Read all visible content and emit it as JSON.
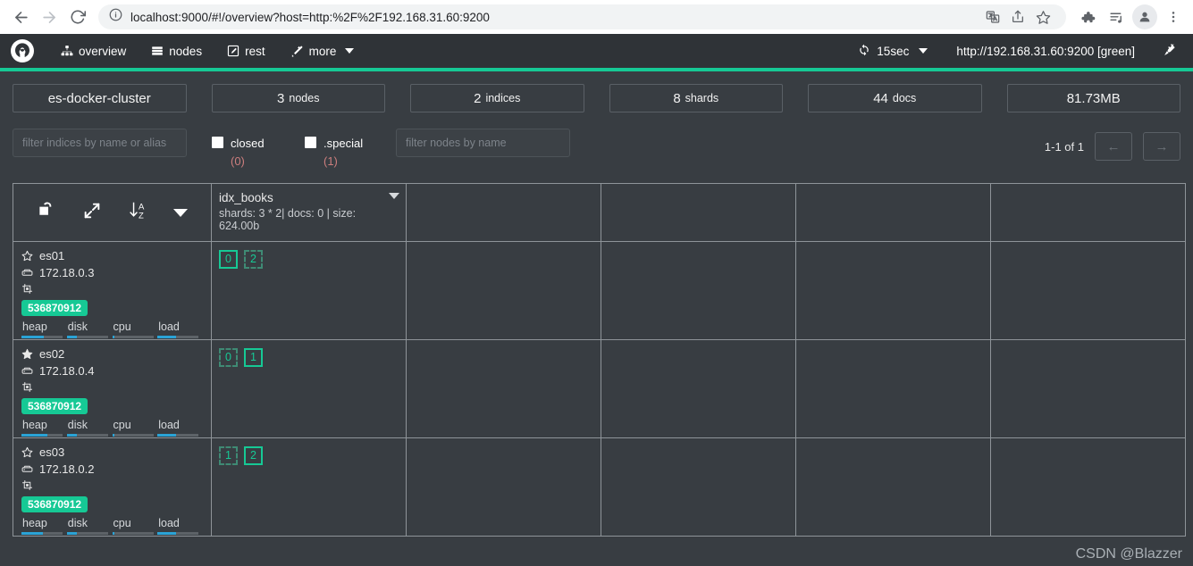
{
  "browser": {
    "url": "localhost:9000/#!/overview?host=http:%2F%2F192.168.31.60:9200",
    "back_icon": "back-arrow-icon",
    "forward_icon": "forward-arrow-icon",
    "reload_icon": "reload-icon",
    "info_icon": "site-info-icon",
    "translate_icon": "translate-icon",
    "share_icon": "share-icon",
    "bookmark_icon": "star-icon",
    "extensions_icon": "puzzle-icon",
    "reading_list_icon": "reading-list-icon",
    "profile_icon": "profile-avatar-icon",
    "menu_icon": "three-dot-menu-icon"
  },
  "app_header": {
    "logo": "cerebro-logo",
    "nav": [
      {
        "label": "overview",
        "icon": "sitemap-icon"
      },
      {
        "label": "nodes",
        "icon": "server-icon"
      },
      {
        "label": "rest",
        "icon": "edit-square-icon"
      },
      {
        "label": "more",
        "icon": "magic-wand-icon",
        "has_caret": true
      }
    ],
    "refresh": {
      "icon": "refresh-icon",
      "interval": "15sec"
    },
    "cluster_url": "http://192.168.31.60:9200 [green]",
    "disconnect_icon": "plug-icon"
  },
  "stats": [
    {
      "value": "es-docker-cluster",
      "label": ""
    },
    {
      "value": "3",
      "label": "nodes"
    },
    {
      "value": "2",
      "label": "indices"
    },
    {
      "value": "8",
      "label": "shards"
    },
    {
      "value": "44",
      "label": "docs"
    },
    {
      "value": "81.73MB",
      "label": ""
    }
  ],
  "filters": {
    "indices_placeholder": "filter indices by name or alias",
    "indices_value": "",
    "nodes_placeholder": "filter nodes by name",
    "nodes_value": "",
    "checkboxes": [
      {
        "label": "closed",
        "count": "(0)",
        "checked": false
      },
      {
        "label": ".special",
        "count": "(1)",
        "checked": false
      }
    ]
  },
  "pagination": {
    "text": "1-1 of 1",
    "prev": "←",
    "next": "→"
  },
  "table": {
    "controls": [
      {
        "icon": "unlock-icon"
      },
      {
        "icon": "expand-arrows-icon"
      },
      {
        "icon": "sort-alpha-asc-icon"
      },
      {
        "icon": "chevron-down-icon"
      }
    ],
    "index_columns": [
      {
        "name": "idx_books",
        "meta": "shards: 3 * 2| docs: 0 | size: 624.00b",
        "caret_icon": "chevron-down-icon"
      }
    ],
    "empty_column_count": 4,
    "nodes": [
      {
        "name": "es01",
        "master": false,
        "star_icon": "star-outline-icon",
        "host_icon": "hdd-icon",
        "host": "172.18.0.3",
        "role_icon": "node-role-icon",
        "heap_bytes": "536870912",
        "metrics": [
          {
            "label": "heap",
            "percent": 55
          },
          {
            "label": "disk",
            "percent": 25
          },
          {
            "label": "cpu",
            "percent": 6
          },
          {
            "label": "load",
            "percent": 45
          }
        ],
        "shards": [
          {
            "id": "0",
            "type": "primary"
          },
          {
            "id": "2",
            "type": "replica"
          }
        ]
      },
      {
        "name": "es02",
        "master": true,
        "star_icon": "star-filled-icon",
        "host_icon": "hdd-icon",
        "host": "172.18.0.4",
        "role_icon": "node-role-icon",
        "heap_bytes": "536870912",
        "metrics": [
          {
            "label": "heap",
            "percent": 62
          },
          {
            "label": "disk",
            "percent": 25
          },
          {
            "label": "cpu",
            "percent": 6
          },
          {
            "label": "load",
            "percent": 45
          }
        ],
        "shards": [
          {
            "id": "0",
            "type": "replica"
          },
          {
            "id": "1",
            "type": "primary"
          }
        ]
      },
      {
        "name": "es03",
        "master": false,
        "star_icon": "star-outline-icon",
        "host_icon": "hdd-icon",
        "host": "172.18.0.2",
        "role_icon": "node-role-icon",
        "heap_bytes": "536870912",
        "metrics": [
          {
            "label": "heap",
            "percent": 52
          },
          {
            "label": "disk",
            "percent": 25
          },
          {
            "label": "cpu",
            "percent": 6
          },
          {
            "label": "load",
            "percent": 45
          }
        ],
        "shards": [
          {
            "id": "1",
            "type": "replica"
          },
          {
            "id": "2",
            "type": "primary"
          }
        ]
      }
    ]
  },
  "watermark": "CSDN @Blazzer",
  "colors": {
    "accent_green": "#16c995",
    "header_bg": "#2f3337",
    "page_bg": "#383d42",
    "metric_blue": "#2aa3d6"
  }
}
